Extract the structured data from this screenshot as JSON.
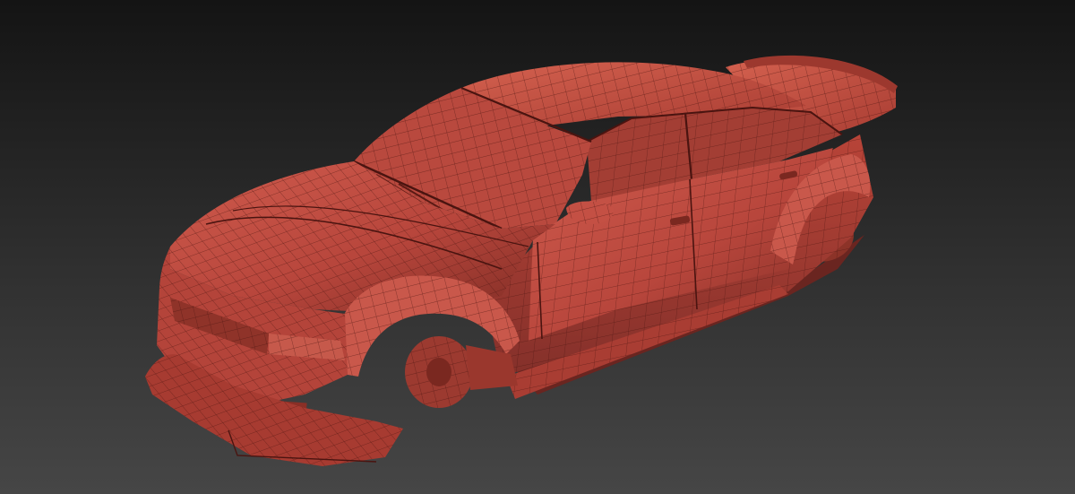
{
  "viewport": {
    "background_top": "#141414",
    "background_bottom": "#464646"
  },
  "model": {
    "subject": "car-body-wireframe-mesh",
    "shaded_color": "#b8463c",
    "shade_light": "#d05a4c",
    "shade_dark": "#7a2820",
    "wire_color": "#4a1410"
  }
}
